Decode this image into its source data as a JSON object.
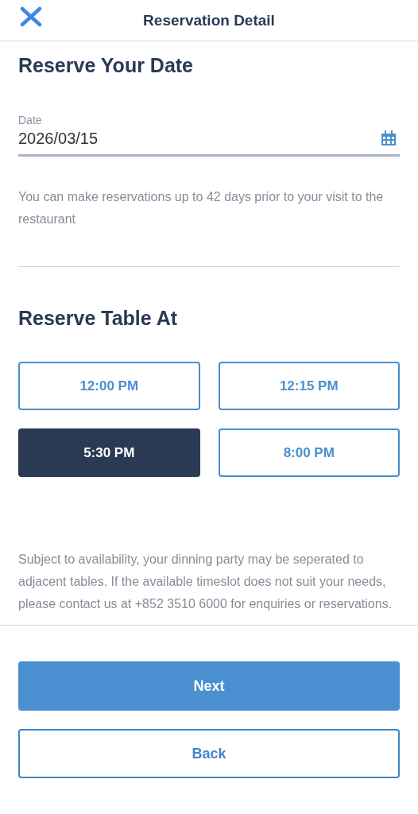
{
  "header": {
    "title": "Reservation Detail"
  },
  "date_section": {
    "heading": "Reserve Your Date",
    "field_label": "Date",
    "value": "2026/03/15",
    "note": "You can make reservations up to 42 days prior to your visit to the restaurant"
  },
  "time_section": {
    "heading": "Reserve Table At",
    "slots": [
      {
        "label": "12:00 PM",
        "selected": false
      },
      {
        "label": "12:15 PM",
        "selected": false
      },
      {
        "label": "5:30 PM",
        "selected": true
      },
      {
        "label": "8:00 PM",
        "selected": false
      }
    ],
    "note": "Subject to availability, your dinning party may be seperated to adjacent tables. If the available timeslot does not suit your needs, please contact us at +852 3510 6000 for enquiries or reservations."
  },
  "buttons": [
    {
      "label": "Next",
      "kind": "primary"
    },
    {
      "label": "Back",
      "kind": "secondary"
    }
  ]
}
